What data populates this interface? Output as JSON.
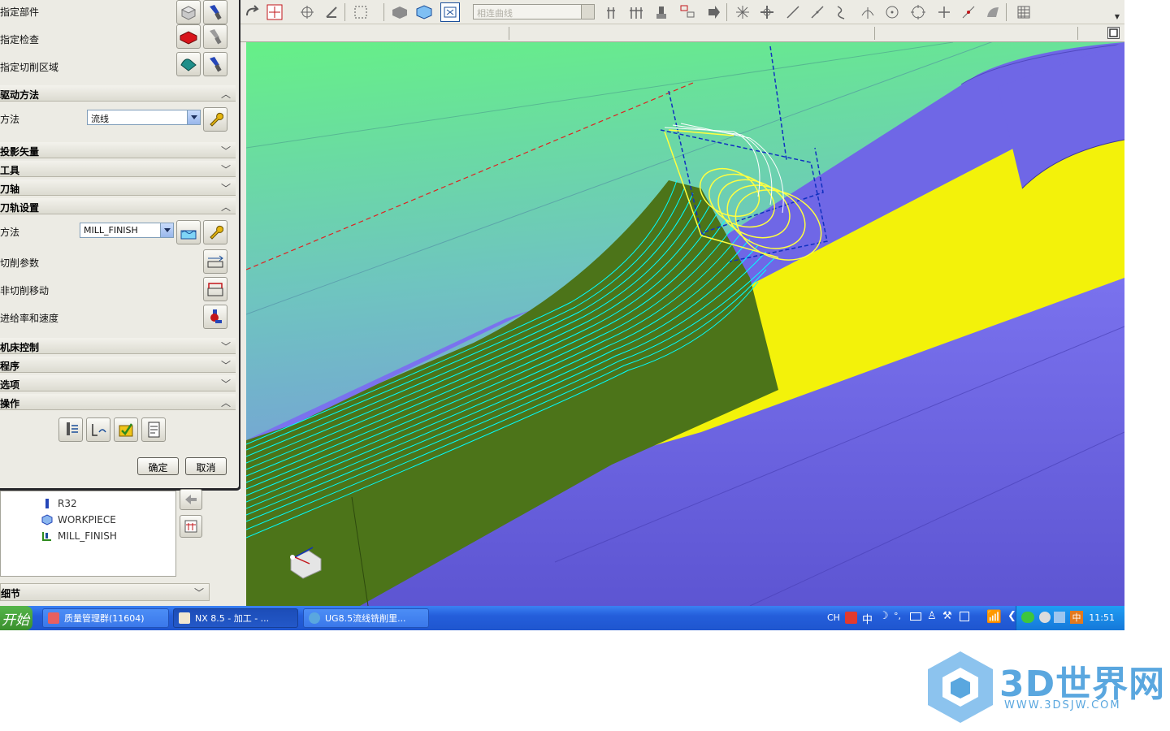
{
  "dialog": {
    "geometry_rows": [
      {
        "label": "指定部件"
      },
      {
        "label": "指定检查"
      },
      {
        "label": "指定切削区域"
      }
    ],
    "sections": {
      "drive_method": "驱动方法",
      "projection_vector": "投影矢量",
      "tool": "工具",
      "tool_axis": "刀轴",
      "path_settings": "刀轨设置",
      "machine_control": "机床控制",
      "program": "程序",
      "options": "选项",
      "actions": "操作"
    },
    "drive_method_label": "方法",
    "drive_method_value": "流线",
    "path_method_label": "方法",
    "path_method_value": "MILL_FINISH",
    "cut_params_label": "切削参数",
    "non_cut_moves_label": "非切削移动",
    "feeds_speeds_label": "进给率和速度",
    "ok_label": "确定",
    "cancel_label": "取消"
  },
  "toolbar": {
    "filter_placeholder": "相连曲线"
  },
  "nav_tree": {
    "items": [
      {
        "label": "R32",
        "icon": "tool-icon"
      },
      {
        "label": "WORKPIECE",
        "icon": "workpiece-icon"
      },
      {
        "label": "MILL_FINISH",
        "icon": "method-icon"
      }
    ],
    "details_label": "细节"
  },
  "taskbar": {
    "start_label": "开始",
    "tasks": [
      {
        "label": "质量管理群(11604)"
      },
      {
        "label": "NX 8.5 - 加工 - ..."
      },
      {
        "label": "UG8.5流线铣削里..."
      }
    ],
    "ime_label": "CH",
    "ime_mode": "中",
    "tray_ime": "中",
    "clock": "11:51"
  },
  "watermark": {
    "brand": "3D世界网",
    "url": "WWW.3DSJW.COM"
  },
  "colors": {
    "part_purple": "#6c63e0",
    "part_yellow": "#f3f30a",
    "part_green": "#4a7519",
    "toolpath_cyan": "#00ffff",
    "tool_yellow": "#ffff40",
    "taskbar_blue": "#245edb"
  }
}
